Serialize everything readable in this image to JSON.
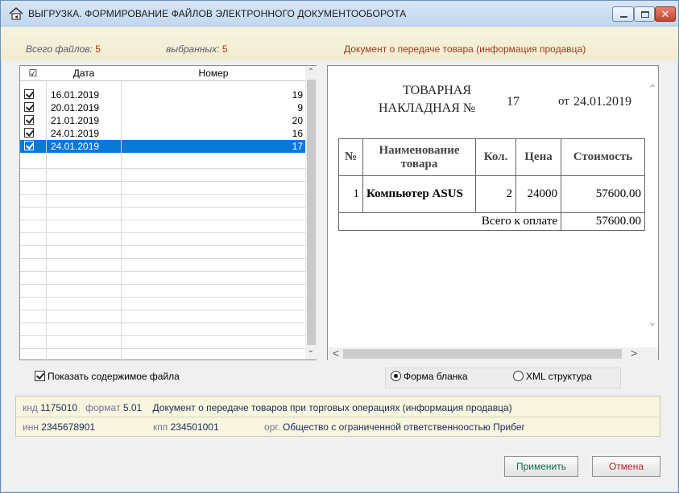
{
  "window": {
    "title": "ВЫГРУЗКА.  ФОРМИРОВАНИЕ ФАЙЛОВ ЭЛЕКТРОННОГО ДОКУМЕНТООБОРОТА",
    "close_glyph": "✕"
  },
  "summary": {
    "total_label": "Всего файлов:",
    "total_value": "5",
    "selected_label": "выбранных:",
    "selected_value": "5",
    "document_type": "Документ о передаче товара (информация продавца)"
  },
  "file_list": {
    "columns": [
      "☑",
      "Дата",
      "Номер"
    ],
    "rows": [
      {
        "date": "16.01.2019",
        "number": "19",
        "checked": true,
        "selected": false
      },
      {
        "date": "20.01.2019",
        "number": "9",
        "checked": true,
        "selected": false
      },
      {
        "date": "21.01.2019",
        "number": "20",
        "checked": true,
        "selected": false
      },
      {
        "date": "24.01.2019",
        "number": "16",
        "checked": true,
        "selected": false
      },
      {
        "date": "24.01.2019",
        "number": "17",
        "checked": true,
        "selected": true
      }
    ]
  },
  "preview": {
    "heading_line1": "ТОВАРНАЯ",
    "heading_line2": "НАКЛАДНАЯ  №",
    "doc_number": "17",
    "from_label": "от",
    "doc_date": "24.01.2019",
    "table": {
      "headers": [
        "№",
        "Наименование товара",
        "Кол.",
        "Цена",
        "Стоимость"
      ],
      "rows": [
        {
          "n": "1",
          "name": "Компьютер ASUS",
          "qty": "2",
          "price": "24000",
          "sum": "57600.00"
        }
      ],
      "total_label": "Всего к оплате",
      "total_value": "57600.00"
    }
  },
  "options": {
    "show_content_label": "Показать содержимое файла",
    "form_label": "Форма бланка",
    "xml_label": "XML структура"
  },
  "meta": {
    "knd_label": "кнд",
    "knd_value": "1175010",
    "format_label": "формат",
    "format_value": "5.01",
    "doc_desc": "Документ о передаче товаров при торговых операциях (информация продавца)",
    "inn_label": "инн",
    "inn_value": "2345678901",
    "kpp_label": "кпп",
    "kpp_value": "234501001",
    "org_label": "орг.",
    "org_value": "Общество с ограниченной ответственноостью Прибег"
  },
  "buttons": {
    "apply": "Применить",
    "cancel": "Отмена"
  }
}
